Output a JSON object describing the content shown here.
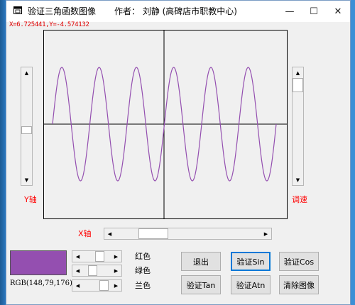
{
  "window": {
    "title": "验证三角函数图像",
    "author": "作者： 刘静 (高碑店市职教中心)",
    "controls": {
      "minimize": "—",
      "maximize": "☐",
      "close": "✕"
    }
  },
  "coords_text": "X=6.725441,Y=-4.574132",
  "labels": {
    "y_axis": "Y轴",
    "x_axis": "X轴",
    "speed": "调速",
    "red": "红色",
    "green": "绿色",
    "blue": "兰色"
  },
  "color": {
    "swatch": "#944FB0",
    "rgb_text": "RGB(148,79,176)",
    "curve": "#944FB0"
  },
  "buttons": {
    "exit": "退出",
    "sin": "验证Sin",
    "cos": "验证Cos",
    "tan": "验证Tan",
    "atn": "验证Atn",
    "clear": "清除图像"
  },
  "plot": {
    "function": "sin",
    "cycles": 6,
    "background": "#F0F0F0",
    "axis_color": "#000000"
  }
}
